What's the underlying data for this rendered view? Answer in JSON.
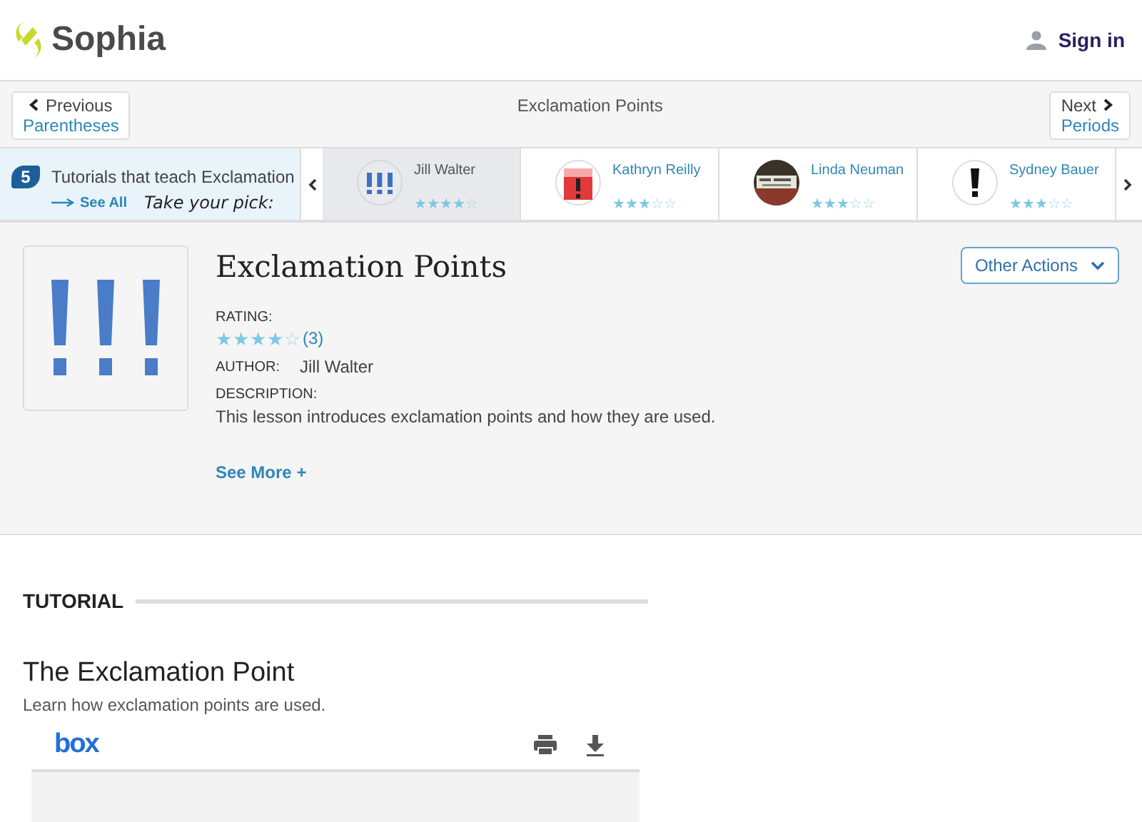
{
  "header": {
    "logo": "Sophia",
    "sign_in": "Sign in"
  },
  "nav": {
    "previous": {
      "label": "Previous",
      "title": "Parentheses"
    },
    "current": "Exclamation Points",
    "next": {
      "label": "Next",
      "title": "Periods"
    }
  },
  "tutorial_strip": {
    "count": "5",
    "heading": "Tutorials that teach Exclamation",
    "see_all": "See All",
    "pick": "Take your pick:",
    "tutorials": [
      {
        "author": "Jill Walter",
        "stars": 4,
        "selected": true,
        "kind": "marks"
      },
      {
        "author": "Kathryn Reilly",
        "stars": 3,
        "selected": false,
        "kind": "sign"
      },
      {
        "author": "Linda Neuman",
        "stars": 3,
        "selected": false,
        "kind": "picture"
      },
      {
        "author": "Sydney Bauer",
        "stars": 3,
        "selected": false,
        "kind": "mark"
      }
    ]
  },
  "lesson": {
    "title": "Exclamation Points",
    "other_actions": "Other Actions",
    "rating_label": "RATING:",
    "stars": 4,
    "rating_count": "(3)",
    "author_label": "AUTHOR:",
    "author": "Jill Walter",
    "description_label": "DESCRIPTION:",
    "description": "This lesson introduces exclamation points and how they are used.",
    "see_more": "See More +"
  },
  "tutorial": {
    "section_label": "TUTORIAL",
    "title": "The Exclamation Point",
    "subtitle": "Learn how exclamation points are used.",
    "viewer_logo": "box"
  }
}
